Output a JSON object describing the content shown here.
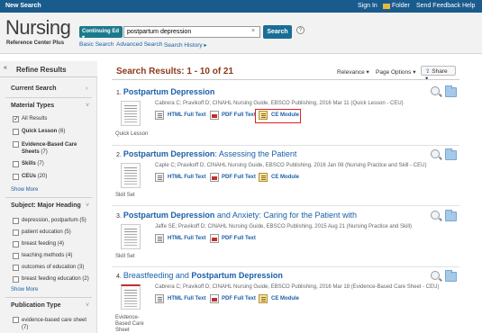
{
  "topbar": {
    "new_search": "New Search",
    "sign_in": "Sign In",
    "folder": "Folder",
    "feedback": "Send Feedback",
    "help": "Help"
  },
  "logo": {
    "title": "Nursing",
    "subtitle": "Reference Center Plus"
  },
  "search": {
    "scope": "Continuing Ed",
    "query": "postpartum depression",
    "button": "Search",
    "clear": "×",
    "help": "?",
    "basic": "Basic Search",
    "advanced": "Advanced Search",
    "history": "Search History ▸"
  },
  "sidebar": {
    "title": "Refine Results",
    "collapse": "«",
    "current_search": "Current Search",
    "material_types": "Material Types",
    "material_items": [
      {
        "label": "All Results",
        "count": "",
        "checked": true
      },
      {
        "label": "Quick Lesson",
        "count": "(6)",
        "checked": false
      },
      {
        "label": "Evidence-Based Care Sheets",
        "count": "(7)",
        "checked": false
      },
      {
        "label": "Skills",
        "count": "(7)",
        "checked": false
      },
      {
        "label": "CEUs",
        "count": "(20)",
        "checked": false
      }
    ],
    "show_more_1": "Show More",
    "subject_heading": "Subject: Major Heading",
    "subject_items": [
      {
        "label": "depression, postpartum",
        "count": "(5)"
      },
      {
        "label": "patient education",
        "count": "(5)"
      },
      {
        "label": "breast feeding",
        "count": "(4)"
      },
      {
        "label": "teaching methods",
        "count": "(4)"
      },
      {
        "label": "outcomes of education",
        "count": "(3)"
      },
      {
        "label": "breast feeding education",
        "count": "(2)"
      }
    ],
    "show_more_2": "Show More",
    "publication_type": "Publication Type",
    "pub_items": [
      {
        "label": "evidence-based care sheet",
        "count": "(7)"
      }
    ]
  },
  "results": {
    "header": "Search Results: 1 - 10 of 21",
    "relevance": "Relevance ▾",
    "page_options": "Page Options ▾",
    "share": "Share ▾",
    "items": [
      {
        "num": "1.",
        "title_hl": "Postpartum Depression",
        "title_rest": "",
        "meta": "Cabrera C; Pravikoff D; CINAHL Nursing Guide, EBSCO Publishing, 2016 Mar 11 (Quick Lesson - CEU)",
        "type": "Quick Lesson",
        "html": "HTML Full Text",
        "pdf": "PDF Full Text",
        "ce": "CE Module"
      },
      {
        "num": "2.",
        "title_hl": "Postpartum Depression",
        "title_rest": ": Assessing the Patient",
        "meta": "Caple C; Pravikoff D; CINAHL Nursing Guide, EBSCO Publishing, 2016 Jan 08 (Nursing Practice and Skill - CEU)",
        "type": "Skill Set",
        "html": "HTML Full Text",
        "pdf": "PDF Full Text",
        "ce": "CE Module"
      },
      {
        "num": "3.",
        "title_hl": "Postpartum Depression",
        "title_rest": " and Anxiety: Caring for the Patient with",
        "meta": "Jaffe SE; Pravikoff D; CINAHL Nursing Guide, EBSCO Publishing, 2015 Aug 21 (Nursing Practice and Skill)",
        "type": "Skill Set",
        "html": "HTML Full Text",
        "pdf": "PDF Full Text",
        "ce": ""
      },
      {
        "num": "4.",
        "title_hl": "Postpartum Depression",
        "title_pre": "Breastfeeding and ",
        "title_rest": "",
        "meta": "Cabrera C; Pravikoff D; CINAHL Nursing Guide, EBSCO Publishing, 2016 Mar 18 (Evidence-Based Care Sheet - CEU)",
        "type": "Evidence-Based Care Sheet",
        "html": "HTML Full Text",
        "pdf": "PDF Full Text",
        "ce": "CE Module"
      }
    ]
  }
}
